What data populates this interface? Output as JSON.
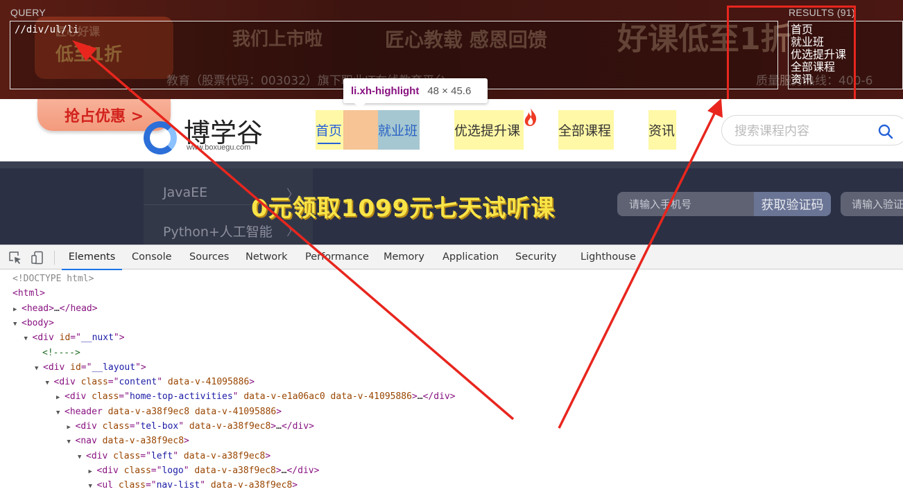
{
  "xpath_helper": {
    "query_label": "QUERY",
    "query_value": "//div/ul/li",
    "results_label": "RESULTS (91)",
    "results": [
      "首页",
      "就业班",
      "优选提升课",
      "全部课程",
      "资讯"
    ]
  },
  "banner": {
    "deco_1": "我们上市啦",
    "deco_2": "匠心教载 感恩回馈",
    "deco_3": "好课低至1折",
    "deco_4": "匠心好课",
    "deco_5": "低至1折",
    "strip_text": "教育（股票代码：003032）旗下职业IT在线教育平台",
    "strip_right": "质量服务热线：400-6"
  },
  "header": {
    "promo_button": "抢占优惠 >",
    "logo_text": "博学谷",
    "logo_sub": "www.boxuegu.com",
    "nav": [
      "首页",
      "就业班",
      "优选提升课",
      "全部课程",
      "资讯"
    ],
    "search_placeholder": "搜索课程内容"
  },
  "promo_band": {
    "side_menu": [
      "JavaEE",
      "Python+人工智能"
    ],
    "headline": "0元领取1099元七天试听课",
    "phone_placeholder": "请输入手机号",
    "verify_button": "获取验证码",
    "phone_placeholder_2": "请输入验证码"
  },
  "tooltip": {
    "selector": "li.xh-highlight",
    "size": "48 × 45.6"
  },
  "devtools": {
    "tabs": [
      "Elements",
      "Console",
      "Sources",
      "Network",
      "Performance",
      "Memory",
      "Application",
      "Security",
      "Lighthouse"
    ],
    "dom": [
      {
        "indent": 0,
        "tw": "",
        "html": "<span class='gray'>&lt;!DOCTYPE html&gt;</span>"
      },
      {
        "indent": 0,
        "tw": "",
        "html": "<span class='tag'>&lt;html&gt;</span>"
      },
      {
        "indent": 0,
        "tw": "▶",
        "html": "<span class='tag'>&lt;head&gt;</span><span class='txt'>…</span><span class='tag'>&lt;/head&gt;</span>"
      },
      {
        "indent": 0,
        "tw": "▼",
        "html": "<span class='tag'>&lt;body&gt;</span>"
      },
      {
        "indent": 1,
        "tw": "▼",
        "html": "<span class='tag'>&lt;div </span><span class='an'>id</span><span class='tag'>=\"</span><span class='av'>__nuxt</span><span class='tag'>\"&gt;</span>"
      },
      {
        "indent": 2,
        "tw": "",
        "html": "<span class='cm'>&lt;!----&gt;</span>"
      },
      {
        "indent": 2,
        "tw": "▼",
        "html": "<span class='tag'>&lt;div </span><span class='an'>id</span><span class='tag'>=\"</span><span class='av'>__layout</span><span class='tag'>\"&gt;</span>"
      },
      {
        "indent": 3,
        "tw": "▼",
        "html": "<span class='tag'>&lt;div </span><span class='an'>class</span><span class='tag'>=\"</span><span class='av'>content</span><span class='tag'>\" </span><span class='an'>data-v-41095886</span><span class='tag'>&gt;</span>"
      },
      {
        "indent": 4,
        "tw": "▶",
        "html": "<span class='tag'>&lt;div </span><span class='an'>class</span><span class='tag'>=\"</span><span class='av'>home-top-activities</span><span class='tag'>\" </span><span class='an'>data-v-e1a06ac0</span> <span class='an'>data-v-41095886</span><span class='tag'>&gt;</span><span class='txt'>…</span><span class='tag'>&lt;/div&gt;</span>"
      },
      {
        "indent": 4,
        "tw": "▼",
        "html": "<span class='tag'>&lt;header </span><span class='an'>data-v-a38f9ec8</span> <span class='an'>data-v-41095886</span><span class='tag'>&gt;</span>"
      },
      {
        "indent": 5,
        "tw": "▶",
        "html": "<span class='tag'>&lt;div </span><span class='an'>class</span><span class='tag'>=\"</span><span class='av'>tel-box</span><span class='tag'>\" </span><span class='an'>data-v-a38f9ec8</span><span class='tag'>&gt;</span><span class='txt'>…</span><span class='tag'>&lt;/div&gt;</span>"
      },
      {
        "indent": 5,
        "tw": "▼",
        "html": "<span class='tag'>&lt;nav </span><span class='an'>data-v-a38f9ec8</span><span class='tag'>&gt;</span>"
      },
      {
        "indent": 6,
        "tw": "▼",
        "html": "<span class='tag'>&lt;div </span><span class='an'>class</span><span class='tag'>=\"</span><span class='av'>left</span><span class='tag'>\" </span><span class='an'>data-v-a38f9ec8</span><span class='tag'>&gt;</span>"
      },
      {
        "indent": 7,
        "tw": "▶",
        "html": "<span class='tag'>&lt;div </span><span class='an'>class</span><span class='tag'>=\"</span><span class='av'>logo</span><span class='tag'>\" </span><span class='an'>data-v-a38f9ec8</span><span class='tag'>&gt;</span><span class='txt'>…</span><span class='tag'>&lt;/div&gt;</span>"
      },
      {
        "indent": 7,
        "tw": "▼",
        "html": "<span class='tag'>&lt;ul </span><span class='an'>class</span><span class='tag'>=\"</span><span class='av'>nav-list</span><span class='tag'>\" </span><span class='an'>data-v-a38f9ec8</span><span class='tag'>&gt;</span>"
      }
    ]
  },
  "colors": {
    "annotation_red": "#e8261e",
    "nav_active": "#2361d8",
    "highlight_yellow": "#fff8a6",
    "promo_yellow": "#f8e447"
  }
}
